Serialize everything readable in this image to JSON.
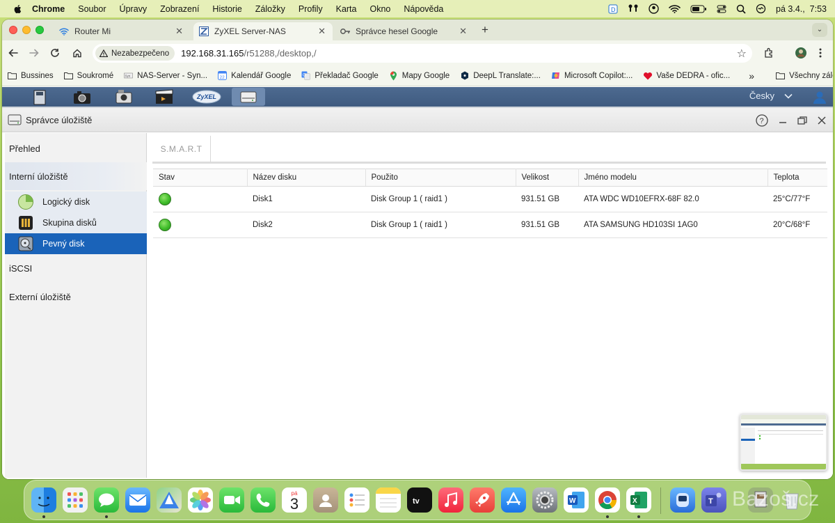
{
  "menubar": {
    "app": "Chrome",
    "items": [
      "Soubor",
      "Úpravy",
      "Zobrazení",
      "Historie",
      "Záložky",
      "Profily",
      "Karta",
      "Okno",
      "Nápověda"
    ],
    "clock": "pá 3.4.,  7:53"
  },
  "tabs": [
    {
      "title": "Router Mi",
      "icon": "wifi-icon"
    },
    {
      "title": "ZyXEL Server-NAS",
      "icon": "zyxel-icon"
    },
    {
      "title": "Správce hesel Google",
      "icon": "key-icon"
    }
  ],
  "address": {
    "security": "Nezabezpečeno",
    "host": "192.168.31.165",
    "path": "/r51288,/desktop,/"
  },
  "bookmarks": [
    {
      "label": "Bussines",
      "icon": "folder-icon"
    },
    {
      "label": "Soukromé",
      "icon": "folder-icon"
    },
    {
      "label": "NAS-Server - Syn...",
      "icon": "synology-icon"
    },
    {
      "label": "Kalendář Google",
      "icon": "calendar-icon"
    },
    {
      "label": "Překladač Google",
      "icon": "translate-icon"
    },
    {
      "label": "Mapy Google",
      "icon": "map-pin-icon"
    },
    {
      "label": "DeepL Translate:...",
      "icon": "deepl-icon"
    },
    {
      "label": "Microsoft Copilot:...",
      "icon": "copilot-icon"
    },
    {
      "label": "Vaše DEDRA - ofic...",
      "icon": "heart-icon"
    }
  ],
  "bookmarks_more": "»",
  "all_bookmarks": "Všechny záložky",
  "nas": {
    "language": "Česky",
    "window_title": "Správce úložiště",
    "sidebar": {
      "overview": "Přehled",
      "internal": "Interní úložiště",
      "sub": [
        "Logický disk",
        "Skupina disků",
        "Pevný disk"
      ],
      "iscsi": "iSCSI",
      "external": "Externí úložiště"
    },
    "subtab": "S.M.A.R.T",
    "table": {
      "columns": [
        "Stav",
        "Název disku",
        "Použito",
        "Velikost",
        "Jméno modelu",
        "Teplota"
      ],
      "rows": [
        {
          "status": "ok",
          "name": "Disk1",
          "used": "Disk Group 1 ( raid1 )",
          "size": "931.51 GB",
          "model": "ATA WDC WD10EFRX-68F 82.0",
          "temp": "25°C/77°F"
        },
        {
          "status": "ok",
          "name": "Disk2",
          "used": "Disk Group 1 ( raid1 )",
          "size": "931.51 GB",
          "model": "ATA SAMSUNG HD103SI 1AG0",
          "temp": "20°C/68°F"
        }
      ]
    }
  },
  "dock": {
    "calendar_day": "pá",
    "calendar_date": "3"
  },
  "watermark": "Bazoš.cz"
}
